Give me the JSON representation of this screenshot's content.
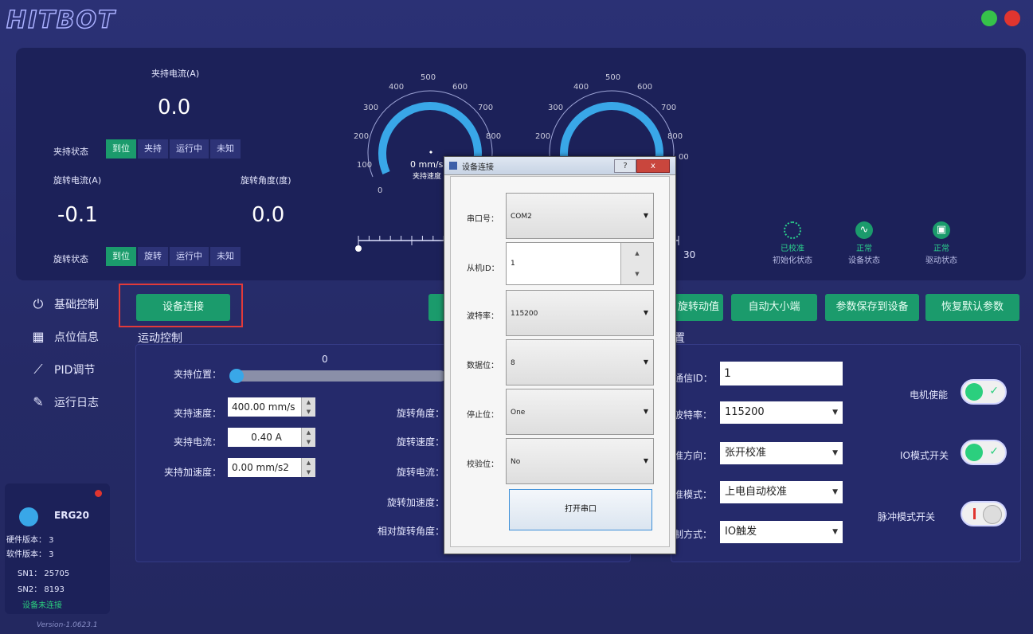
{
  "app": {
    "logo": "HITBOT"
  },
  "gripper": {
    "current_label": "夹持电流(A)",
    "current_value": "0.0",
    "state_label": "夹持状态",
    "state_options": [
      "到位",
      "夹持",
      "运行中",
      "未知"
    ],
    "state_active": 0
  },
  "rotation": {
    "current_label": "旋转电流(A)",
    "current_value": "-0.1",
    "angle_label": "旋转角度(度)",
    "angle_value": "0.0",
    "state_label": "旋转状态",
    "state_options": [
      "到位",
      "旋转",
      "运行中",
      "未知"
    ],
    "state_active": 0
  },
  "gauge1": {
    "ticks": [
      "0",
      "100",
      "200",
      "300",
      "400",
      "500",
      "600",
      "700",
      "800"
    ],
    "readout": "0 mm/s",
    "caption": "夹持速度"
  },
  "gauge2": {
    "ticks": [
      "200",
      "300",
      "400",
      "500",
      "600",
      "700",
      "800",
      "00"
    ]
  },
  "angle_scale": {
    "max_label": "30",
    "level": 0
  },
  "status_icons": [
    {
      "icon": "calibration-icon",
      "title": "已校准",
      "caption": "初始化状态"
    },
    {
      "icon": "wave-icon",
      "title": "正常",
      "caption": "设备状态"
    },
    {
      "icon": "motor-icon",
      "title": "正常",
      "caption": "驱动状态"
    }
  ],
  "sidebar": [
    {
      "icon": "power-icon",
      "label": "基础控制"
    },
    {
      "icon": "grid-icon",
      "label": "点位信息"
    },
    {
      "icon": "pid-icon",
      "label": "PID调节"
    },
    {
      "icon": "log-icon",
      "label": "运行日志"
    }
  ],
  "toolbar": {
    "connect": "设备连接",
    "rotate_value": "旋转动值",
    "auto_size": "自动大小端",
    "save_params": "参数保存到设备",
    "restore": "恢复默认参数"
  },
  "motion": {
    "title": "运动控制",
    "position_label": "夹持位置：",
    "position_value": "0",
    "speed_label": "夹持速度：",
    "speed_value": "400.00 mm/s",
    "current_label": "夹持电流：",
    "current_value": "0.40 A",
    "accel_label": "夹持加速度：",
    "accel_value": "0.00 mm/s2",
    "rot_angle": "旋转角度：",
    "rot_speed": "旋转速度：",
    "rot_current": "旋转电流：",
    "rot_accel": "旋转加速度：",
    "rel_angle": "相对旋转角度："
  },
  "settings": {
    "title": "置",
    "comm_id_label": "通信ID：",
    "comm_id_value": "1",
    "baud_label": "波特率：",
    "baud_value": "115200",
    "calib_dir_label": "准方向：",
    "calib_dir_value": "张开校准",
    "calib_mode_label": "准模式：",
    "calib_mode_value": "上电自动校准",
    "control_label": "制方式：",
    "control_value": "IO触发",
    "motor_enable": "电机使能",
    "io_mode": "IO模式开关",
    "pulse_mode": "脉冲模式开关"
  },
  "device": {
    "name": "ERG20",
    "hw": "硬件版本： 3",
    "sw": "软件版本： 3",
    "sn1": "SN1： 25705",
    "sn2": "SN2： 8193",
    "status": "设备未连接",
    "version": "Version-1.0623.1"
  },
  "dialog": {
    "title": "设备连接",
    "help": "?",
    "close": "x",
    "port_label": "串口号：",
    "port_value": "COM2",
    "slave_label": "从机ID：",
    "slave_value": "1",
    "baud_label": "波特率：",
    "baud_value": "115200",
    "databits_label": "数据位：",
    "databits_value": "8",
    "stopbits_label": "停止位：",
    "stopbits_value": "One",
    "parity_label": "校验位：",
    "parity_value": "No",
    "open_button": "打开串口"
  },
  "colors": {
    "accent": "#1b9b6c",
    "panel": "#1c2159",
    "gauge": "#39a7e8",
    "highlight": "#e23a3a"
  }
}
